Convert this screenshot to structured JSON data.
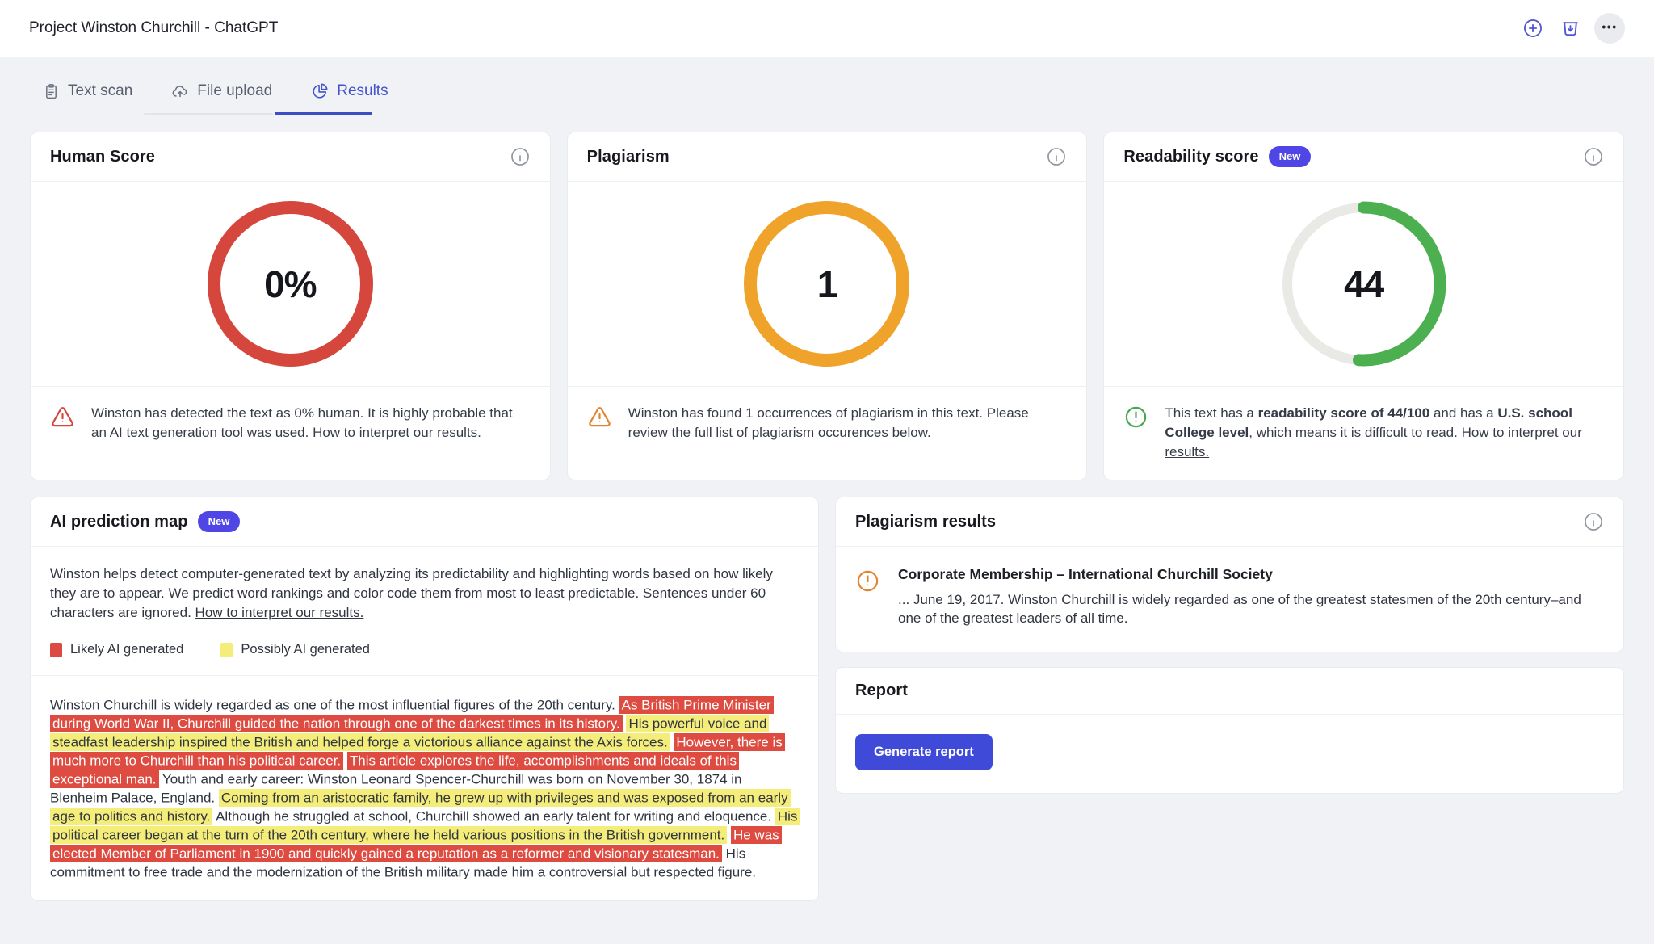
{
  "colors": {
    "accent": "#4353cc",
    "badge": "#4f46e5",
    "button": "#3f4ad8",
    "hl_red": "#de4b41",
    "hl_yellow": "#f5ed79",
    "ring_red": "#d5463d",
    "ring_orange": "#f0a32a",
    "ring_green": "#4caf50",
    "warning_red": "#d5463d",
    "warning_orange": "#e0862f",
    "success_green": "#44a94c"
  },
  "icons": {
    "ellipsis": "•••"
  },
  "header": {
    "title": "Project Winston Churchill - ChatGPT"
  },
  "tabs": [
    {
      "label": "Text scan",
      "active": false
    },
    {
      "label": "File upload",
      "active": false
    },
    {
      "label": "Results",
      "active": true
    }
  ],
  "cards": {
    "human_score": {
      "title": "Human Score",
      "value": "0%",
      "ring": {
        "color": "#d5463d",
        "percent": 100
      },
      "message_parts": [
        {
          "text": "Winston has detected the text as 0% human. It is highly probable that an AI text generation tool was used. "
        },
        {
          "text": "How to interpret our results.",
          "link": true
        }
      ]
    },
    "plagiarism": {
      "title": "Plagiarism",
      "value": "1",
      "ring": {
        "color": "#f0a32a",
        "percent": 100
      },
      "message_parts": [
        {
          "text": "Winston has found 1 occurrences of plagiarism in this text. Please review the full list of plagiarism occurences below."
        }
      ]
    },
    "readability": {
      "title": "Readability score",
      "badge": "New",
      "value": "44",
      "score": "44/100",
      "ring": {
        "color": "#4caf50",
        "percent": 51,
        "track": "#e9e9e5"
      },
      "message_parts": [
        {
          "text": "This text has a "
        },
        {
          "text": "readability score of 44/100",
          "bold": true
        },
        {
          "text": " and has a "
        },
        {
          "text": "U.S. school College level",
          "bold": true
        },
        {
          "text": ", which means it is difficult to read. "
        },
        {
          "text": "How to interpret our results.",
          "link": true
        }
      ]
    }
  },
  "prediction_map": {
    "title": "AI prediction map",
    "badge": "New",
    "description_parts": [
      {
        "text": "Winston helps detect computer-generated text by analyzing its predictability and highlighting words based on how likely they are to appear. We predict word rankings and color code them from most to least predictable. Sentences under 60 characters are ignored. "
      },
      {
        "text": "How to interpret our results.",
        "link": true
      }
    ],
    "legend": [
      {
        "color": "#dc4b41",
        "label": "Likely AI generated"
      },
      {
        "color": "#f5ed79",
        "label": "Possibly AI generated"
      }
    ],
    "segments": [
      {
        "type": "plain",
        "text": "Winston Churchill is widely regarded as one of the most influential figures of the 20th century."
      },
      {
        "type": "red",
        "text": "As British Prime Minister during World War II, Churchill guided the nation through one of the darkest times in its history."
      },
      {
        "type": "yellow",
        "text": "His powerful voice and steadfast leadership inspired the British and helped forge a victorious alliance against the Axis forces."
      },
      {
        "type": "red",
        "text": "However, there is much more to Churchill than his political career."
      },
      {
        "type": "red",
        "text": "This article explores the life, accomplishments and ideals of this exceptional man."
      },
      {
        "type": "plain",
        "text": "Youth and early career: Winston Leonard Spencer-Churchill was born on November 30, 1874 in Blenheim Palace, England."
      },
      {
        "type": "yellow",
        "text": "Coming from an aristocratic family, he grew up with privileges and was exposed from an early age to politics and history."
      },
      {
        "type": "plain",
        "text": "Although he struggled at school, Churchill showed an early talent for writing and eloquence."
      },
      {
        "type": "yellow",
        "text": "His political career began at the turn of the 20th century, where he held various positions in the British government."
      },
      {
        "type": "red",
        "text": "He was elected Member of Parliament in 1900 and quickly gained a reputation as a reformer and visionary statesman."
      },
      {
        "type": "plain",
        "text": "His commitment to free trade and the modernization of the British military made him a controversial but respected figure."
      }
    ]
  },
  "plagiarism_results": {
    "title": "Plagiarism results",
    "items": [
      {
        "title": "Corporate Membership – International Churchill Society",
        "snippet": "... June 19, 2017. Winston Churchill is widely regarded as one of the greatest statesmen of the 20th century–and one of the greatest leaders of all time."
      }
    ]
  },
  "report": {
    "title": "Report",
    "button_label": "Generate report"
  }
}
